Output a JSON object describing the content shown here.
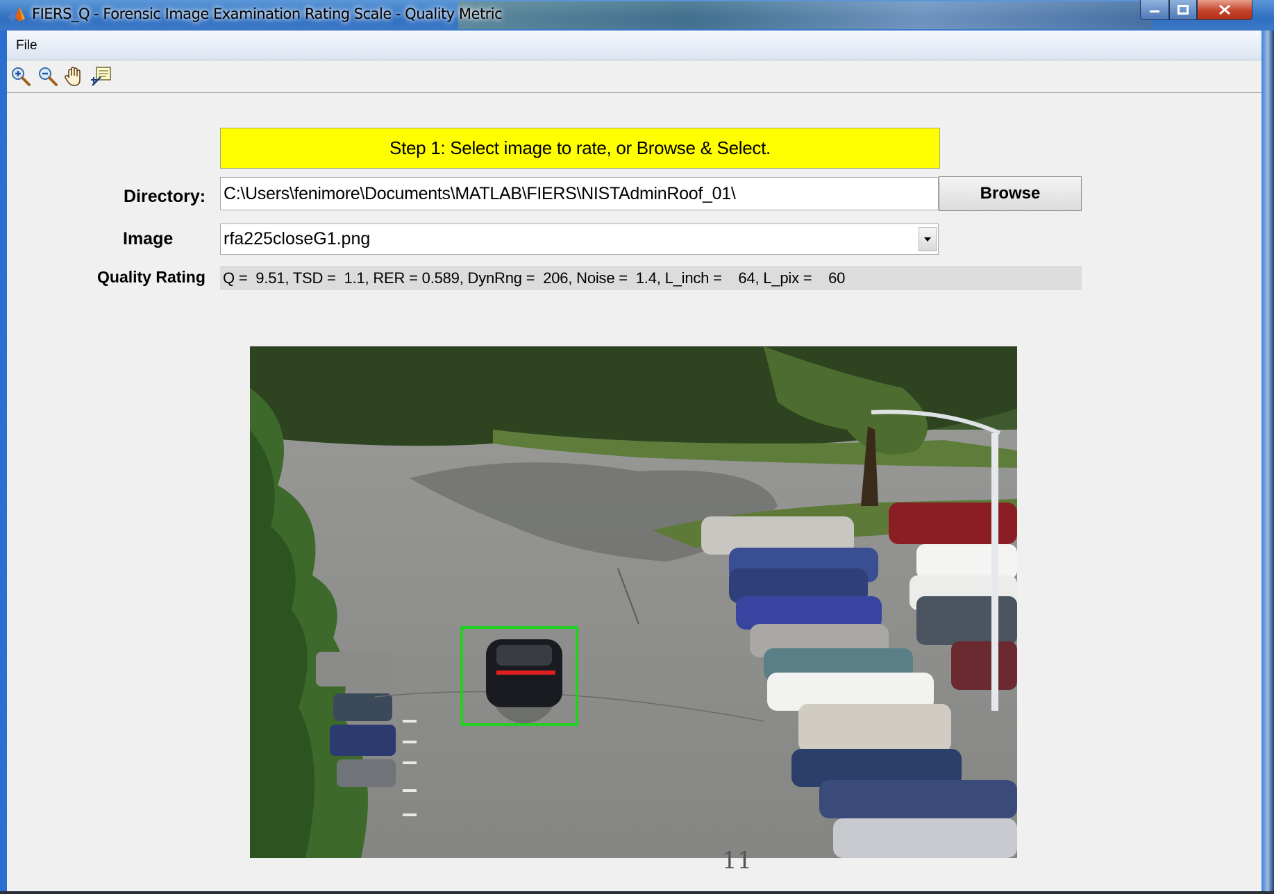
{
  "window": {
    "title": "FIERS_Q - Forensic Image Examination Rating Scale - Quality Metric"
  },
  "menu": {
    "file_label": "File"
  },
  "toolbar": {
    "tools": [
      "zoom-in-icon",
      "zoom-out-icon",
      "pan-hand-icon",
      "data-cursor-icon"
    ]
  },
  "form": {
    "step_message": "Step 1: Select image to rate, or Browse & Select.",
    "directory_label": "Directory:",
    "directory_value": "C:\\Users\\fenimore\\Documents\\MATLAB\\FIERS\\NISTAdminRoof_01\\",
    "browse_label": "Browse",
    "image_label": "Image",
    "image_selected": "rfa225closeG1.png",
    "quality_label": "Quality Rating",
    "quality_value": "Q =  9.51, TSD =  1.1, RER = 0.589, DynRng =  206, Noise =  1.4, L_inch =    64, L_pix =    60"
  },
  "colors": {
    "banner": "#ffff00",
    "selection_box": "#22d022",
    "measure_line": "#e02020"
  },
  "footer": {
    "page_number": "11"
  }
}
